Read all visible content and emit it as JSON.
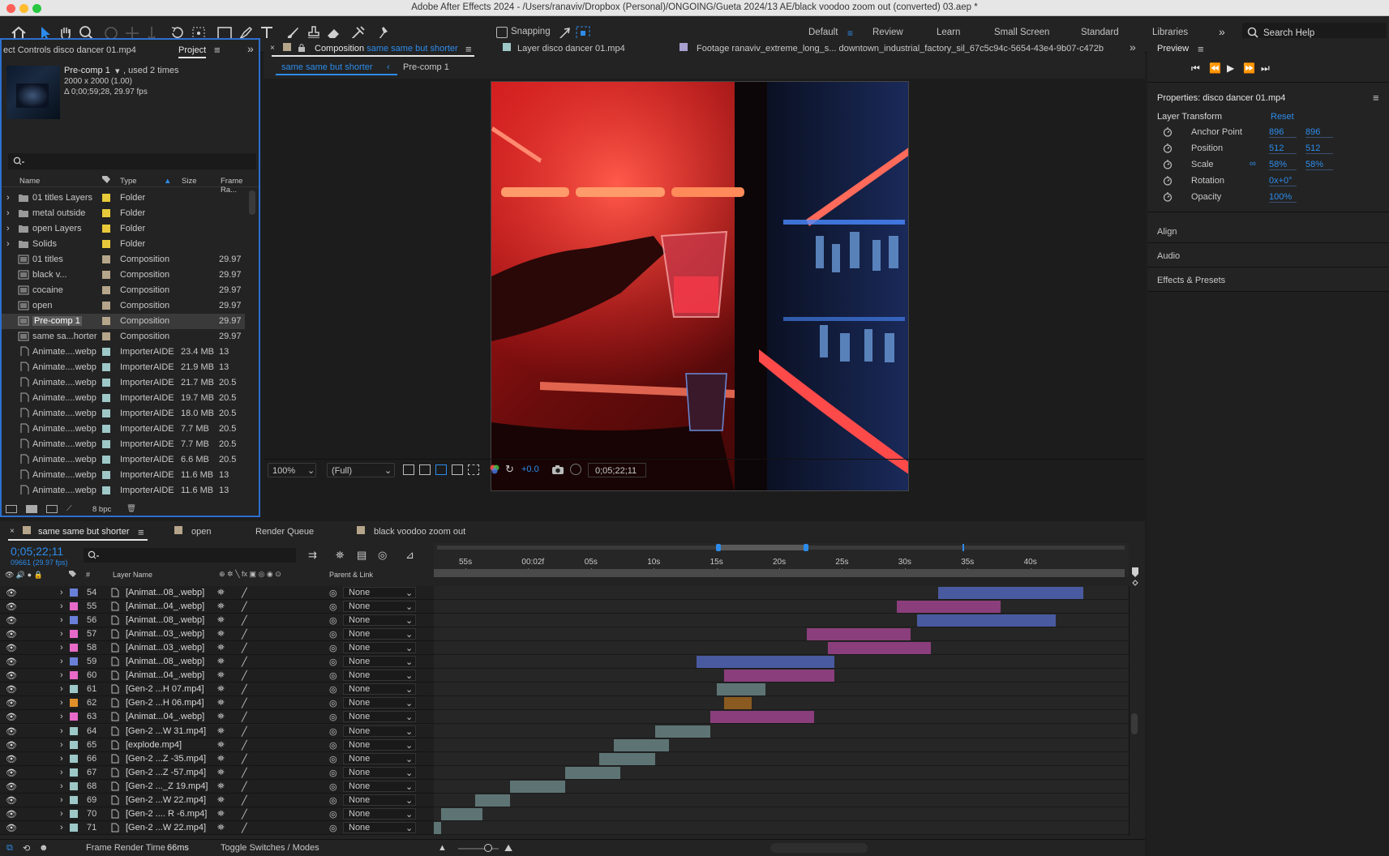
{
  "window": {
    "title": "Adobe After Effects 2024 - /Users/ranaviv/Dropbox (Personal)/ONGOING/Gueta 2024/13 AE/black voodoo zoom out (converted) 03.aep *"
  },
  "toolbar": {
    "snapping_label": "Snapping",
    "workspaces": [
      "Default",
      "Review",
      "Learn",
      "Small Screen",
      "Standard",
      "Libraries"
    ],
    "search_placeholder": "Search Help"
  },
  "project_panel": {
    "tab_effect_controls": "ect Controls disco dancer 01.mp4",
    "tab_project": "Project",
    "selected_item": {
      "name": "Pre-comp 1",
      "used": ", used 2 times",
      "dimensions": "2000 x 2000 (1.00)",
      "duration": "Δ 0;00;59;28, 29.97 fps"
    },
    "columns": [
      "Name",
      "Type",
      "Size",
      "Frame Ra..."
    ],
    "items": [
      {
        "name": "01 titles Layers",
        "type": "Folder",
        "size": "",
        "fps": "",
        "color": "#e8c93a",
        "kind": "folder"
      },
      {
        "name": "metal outside",
        "type": "Folder",
        "size": "",
        "fps": "",
        "color": "#e8c93a",
        "kind": "folder"
      },
      {
        "name": "open Layers",
        "type": "Folder",
        "size": "",
        "fps": "",
        "color": "#e8c93a",
        "kind": "folder"
      },
      {
        "name": "Solids",
        "type": "Folder",
        "size": "",
        "fps": "",
        "color": "#e8c93a",
        "kind": "folder"
      },
      {
        "name": "01 titles",
        "type": "Composition",
        "size": "",
        "fps": "29.97",
        "color": "#b5a58a",
        "kind": "comp"
      },
      {
        "name": "black v...",
        "type": "Composition",
        "size": "",
        "fps": "29.97",
        "color": "#b5a58a",
        "kind": "comp"
      },
      {
        "name": "cocaine",
        "type": "Composition",
        "size": "",
        "fps": "29.97",
        "color": "#b5a58a",
        "kind": "comp"
      },
      {
        "name": "open",
        "type": "Composition",
        "size": "",
        "fps": "29.97",
        "color": "#b5a58a",
        "kind": "comp"
      },
      {
        "name": "Pre-comp 1",
        "type": "Composition",
        "size": "",
        "fps": "29.97",
        "color": "#b5a58a",
        "kind": "comp",
        "selected": true
      },
      {
        "name": "same sa...horter",
        "type": "Composition",
        "size": "",
        "fps": "29.97",
        "color": "#b5a58a",
        "kind": "comp"
      },
      {
        "name": "Animate....webp",
        "type": "ImporterAIDE",
        "size": "23.4 MB",
        "fps": "13",
        "color": "#9ec8c8",
        "kind": "file"
      },
      {
        "name": "Animate....webp",
        "type": "ImporterAIDE",
        "size": "21.9 MB",
        "fps": "13",
        "color": "#9ec8c8",
        "kind": "file"
      },
      {
        "name": "Animate....webp",
        "type": "ImporterAIDE",
        "size": "21.7 MB",
        "fps": "20.5",
        "color": "#9ec8c8",
        "kind": "file"
      },
      {
        "name": "Animate....webp",
        "type": "ImporterAIDE",
        "size": "19.7 MB",
        "fps": "20.5",
        "color": "#9ec8c8",
        "kind": "file"
      },
      {
        "name": "Animate....webp",
        "type": "ImporterAIDE",
        "size": "18.0 MB",
        "fps": "20.5",
        "color": "#9ec8c8",
        "kind": "file"
      },
      {
        "name": "Animate....webp",
        "type": "ImporterAIDE",
        "size": "7.7 MB",
        "fps": "20.5",
        "color": "#9ec8c8",
        "kind": "file"
      },
      {
        "name": "Animate....webp",
        "type": "ImporterAIDE",
        "size": "7.7 MB",
        "fps": "20.5",
        "color": "#9ec8c8",
        "kind": "file"
      },
      {
        "name": "Animate....webp",
        "type": "ImporterAIDE",
        "size": "6.6 MB",
        "fps": "20.5",
        "color": "#9ec8c8",
        "kind": "file"
      },
      {
        "name": "Animate....webp",
        "type": "ImporterAIDE",
        "size": "11.6 MB",
        "fps": "13",
        "color": "#9ec8c8",
        "kind": "file"
      },
      {
        "name": "Animate....webp",
        "type": "ImporterAIDE",
        "size": "11.6 MB",
        "fps": "13",
        "color": "#9ec8c8",
        "kind": "file"
      }
    ],
    "bpc": "8 bpc"
  },
  "viewer": {
    "tab_comp_prefix": "Composition",
    "tab_comp_name": "same same but shorter",
    "tab_layer": "Layer disco dancer 01.mp4",
    "tab_footage": "Footage ranaviv_extreme_long_s... downtown_industrial_factory_sil_67c5c94c-5654-43e4-9b07-c472b",
    "crumb_active": "same same but shorter",
    "crumb_next": "Pre-comp 1",
    "zoom": "100%",
    "resolution": "(Full)",
    "exposure": "+0.0",
    "timecode": "0;05;22;11"
  },
  "right_panel": {
    "preview_title": "Preview",
    "properties_title": "Properties: disco dancer 01.mp4",
    "layer_transform": "Layer Transform",
    "reset": "Reset",
    "properties": [
      {
        "name": "Anchor Point",
        "v1": "896",
        "v2": "896"
      },
      {
        "name": "Position",
        "v1": "512",
        "v2": "512"
      },
      {
        "name": "Scale",
        "v1": "58%",
        "v2": "58%"
      },
      {
        "name": "Rotation",
        "v1": "0x+0°",
        "v2": ""
      },
      {
        "name": "Opacity",
        "v1": "100%",
        "v2": ""
      }
    ],
    "sections": [
      "Align",
      "Audio",
      "Effects & Presets"
    ]
  },
  "timeline": {
    "tabs": [
      "same same but shorter",
      "open",
      "Render Queue",
      "black voodoo zoom out"
    ],
    "timecode": "0;05;22;11",
    "fps_info": "09661 (29.97 fps)",
    "col_layer_name": "Layer Name",
    "col_parent": "Parent & Link",
    "ruler_labels": [
      "55s",
      "00:02f",
      "05s",
      "10s",
      "15s",
      "20s",
      "25s",
      "30s",
      "35s",
      "40s"
    ],
    "layers": [
      {
        "num": "54",
        "name": "[Animat...08_.webp]",
        "color": "#6a7fd8",
        "parent": "None",
        "bars": [
          [
            0.73,
            0.94,
            "#4a5aa0"
          ]
        ]
      },
      {
        "num": "55",
        "name": "[Animat...04_.webp]",
        "color": "#e86ac8",
        "parent": "None",
        "bars": [
          [
            0.67,
            0.82,
            "#8a3e7c"
          ]
        ]
      },
      {
        "num": "56",
        "name": "[Animat...08_.webp]",
        "color": "#6a7fd8",
        "parent": "None",
        "bars": [
          [
            0.7,
            0.9,
            "#4a5aa0"
          ]
        ]
      },
      {
        "num": "57",
        "name": "[Animat...03_.webp]",
        "color": "#e86ac8",
        "parent": "None",
        "bars": [
          [
            0.54,
            0.69,
            "#8a3e7c"
          ]
        ]
      },
      {
        "num": "58",
        "name": "[Animat...03_.webp]",
        "color": "#e86ac8",
        "parent": "None",
        "bars": [
          [
            0.57,
            0.72,
            "#8a3e7c"
          ]
        ]
      },
      {
        "num": "59",
        "name": "[Animat...08_.webp]",
        "color": "#6a7fd8",
        "parent": "None",
        "bars": [
          [
            0.38,
            0.58,
            "#4a5aa0"
          ]
        ]
      },
      {
        "num": "60",
        "name": "[Animat...04_.webp]",
        "color": "#e86ac8",
        "parent": "None",
        "bars": [
          [
            0.42,
            0.58,
            "#8a3e7c"
          ]
        ]
      },
      {
        "num": "61",
        "name": "[Gen-2 ...H 07.mp4]",
        "color": "#9ec8c8",
        "parent": "None",
        "bars": [
          [
            0.41,
            0.48,
            "#5e7474"
          ]
        ]
      },
      {
        "num": "62",
        "name": "[Gen-2 ...H 06.mp4]",
        "color": "#e0902a",
        "parent": "None",
        "bars": [
          [
            0.42,
            0.46,
            "#8a5a20"
          ]
        ]
      },
      {
        "num": "63",
        "name": "[Animat...04_.webp]",
        "color": "#e86ac8",
        "parent": "None",
        "bars": [
          [
            0.4,
            0.55,
            "#8a3e7c"
          ]
        ]
      },
      {
        "num": "64",
        "name": "[Gen-2 ...W 31.mp4]",
        "color": "#9ec8c8",
        "parent": "None",
        "bars": [
          [
            0.32,
            0.4,
            "#5e7474"
          ]
        ]
      },
      {
        "num": "65",
        "name": "[explode.mp4]",
        "color": "#9ec8c8",
        "parent": "None",
        "bars": [
          [
            0.26,
            0.34,
            "#5e7474"
          ]
        ]
      },
      {
        "num": "66",
        "name": "[Gen-2 ...Z -35.mp4]",
        "color": "#9ec8c8",
        "parent": "None",
        "bars": [
          [
            0.24,
            0.32,
            "#5e7474"
          ]
        ]
      },
      {
        "num": "67",
        "name": "[Gen-2 ...Z -57.mp4]",
        "color": "#9ec8c8",
        "parent": "None",
        "bars": [
          [
            0.19,
            0.27,
            "#5e7474"
          ]
        ]
      },
      {
        "num": "68",
        "name": "[Gen-2 ..._Z 19.mp4]",
        "color": "#9ec8c8",
        "parent": "None",
        "bars": [
          [
            0.11,
            0.19,
            "#5e7474"
          ]
        ]
      },
      {
        "num": "69",
        "name": "[Gen-2 ...W 22.mp4]",
        "color": "#9ec8c8",
        "parent": "None",
        "bars": [
          [
            0.06,
            0.11,
            "#5e7474"
          ]
        ]
      },
      {
        "num": "70",
        "name": "[Gen-2 .... R -6.mp4]",
        "color": "#9ec8c8",
        "parent": "None",
        "bars": [
          [
            0.01,
            0.07,
            "#5e7474"
          ]
        ]
      },
      {
        "num": "71",
        "name": "[Gen-2 ...W 22.mp4]",
        "color": "#9ec8c8",
        "parent": "None",
        "bars": [
          [
            0.0,
            0.01,
            "#5e7474"
          ]
        ]
      }
    ],
    "render_time_label": "Frame Render Time",
    "render_time_value": "66ms",
    "toggle_label": "Toggle Switches / Modes"
  }
}
